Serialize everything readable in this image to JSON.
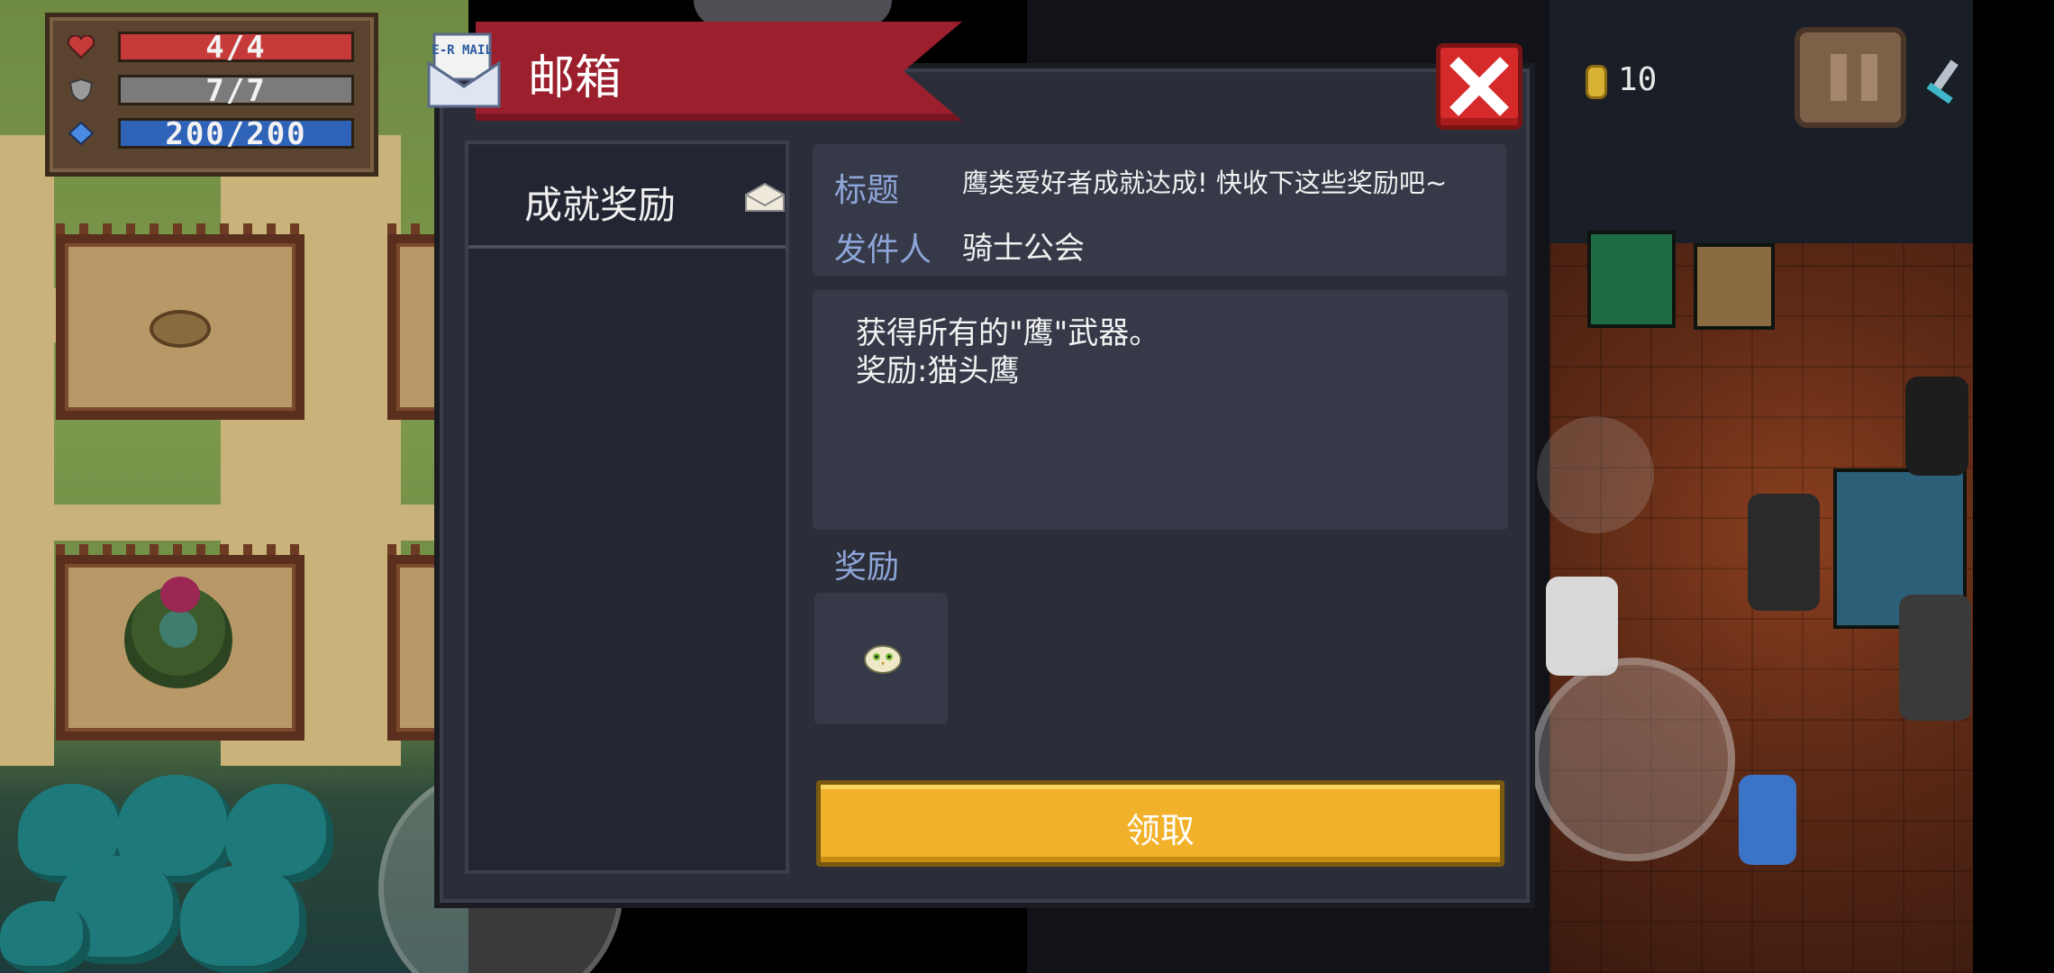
{
  "hud": {
    "health": "4/4",
    "armor": "7/7",
    "energy": "200/200",
    "coins": "10"
  },
  "mailbox": {
    "title": "邮箱",
    "mail_icon_text": "E-R MAIL",
    "list": [
      {
        "label": "成就奖励"
      }
    ],
    "subject_label": "标题",
    "subject": "鹰类爱好者成就达成! 快收下这些奖励吧~",
    "sender_label": "发件人",
    "sender": "骑士公会",
    "body_line1": "获得所有的\"鹰\"武器。",
    "body_line2": "奖励:猫头鹰",
    "reward_label": "奖励",
    "claim_label": "领取"
  },
  "colors": {
    "banner": "#9b1f2d",
    "close_button": "#d62a2a",
    "claim_button": "#f1b12a",
    "label_blue": "#8ea5d8",
    "health_bar": "#c63a3a",
    "armor_bar": "#7b7b7b",
    "energy_bar": "#2f63b8"
  },
  "icons": [
    "heart-icon",
    "shield-icon",
    "diamond-icon",
    "coin-icon",
    "pause-icon",
    "sword-icon",
    "mail-icon",
    "close-icon",
    "envelope-icon",
    "owl-icon"
  ]
}
